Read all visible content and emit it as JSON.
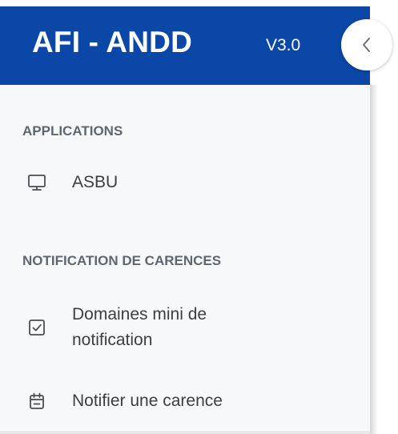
{
  "header": {
    "title": "AFI - ANDD",
    "version": "V3.0",
    "collapse_icon": "chevron-left-icon",
    "background_color": "#0b47a6"
  },
  "sidebar": {
    "sections": [
      {
        "title": "APPLICATIONS",
        "items": [
          {
            "label": "ASBU",
            "icon": "monitor-icon"
          }
        ]
      },
      {
        "title": "NOTIFICATION DE CARENCES",
        "items": [
          {
            "label_line1": "Domaines mini de",
            "label_line2": "notification",
            "icon": "checkbox-icon"
          },
          {
            "label": "Notifier une carence",
            "icon": "calendar-icon"
          }
        ]
      }
    ]
  }
}
